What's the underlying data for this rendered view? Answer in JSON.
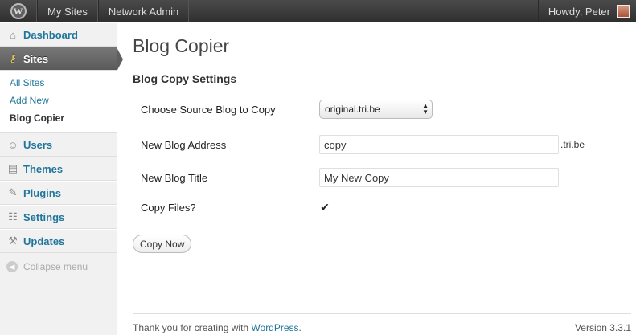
{
  "adminbar": {
    "wp_logo": "W",
    "my_sites": "My Sites",
    "network_admin": "Network Admin",
    "howdy": "Howdy, Peter"
  },
  "sidebar": {
    "dashboard": {
      "label": "Dashboard",
      "icon": "home-icon"
    },
    "sites": {
      "label": "Sites",
      "icon": "key-icon"
    },
    "sites_submenu": [
      "All Sites",
      "Add New",
      "Blog Copier"
    ],
    "users": {
      "label": "Users",
      "icon": "users-icon"
    },
    "themes": {
      "label": "Themes",
      "icon": "themes-icon"
    },
    "plugins": {
      "label": "Plugins",
      "icon": "plugins-icon"
    },
    "settings": {
      "label": "Settings",
      "icon": "settings-icon"
    },
    "updates": {
      "label": "Updates",
      "icon": "updates-icon"
    },
    "collapse": "Collapse menu"
  },
  "page": {
    "title": "Blog Copier",
    "section": "Blog Copy Settings",
    "source_label": "Choose Source Blog to Copy",
    "source_value": "original.tri.be",
    "address_label": "New Blog Address",
    "address_value": "copy",
    "address_suffix": ".tri.be",
    "title_label": "New Blog Title",
    "title_value": "My New Copy",
    "files_label": "Copy Files?",
    "files_checked": true,
    "copy_button": "Copy Now"
  },
  "footer": {
    "thanks": "Thank you for creating with ",
    "link": "WordPress",
    "period": ".",
    "version": "Version 3.3.1"
  },
  "colors": {
    "link": "#21759b",
    "adminbar": "#464646",
    "active_menu": "#6d6d6d"
  }
}
